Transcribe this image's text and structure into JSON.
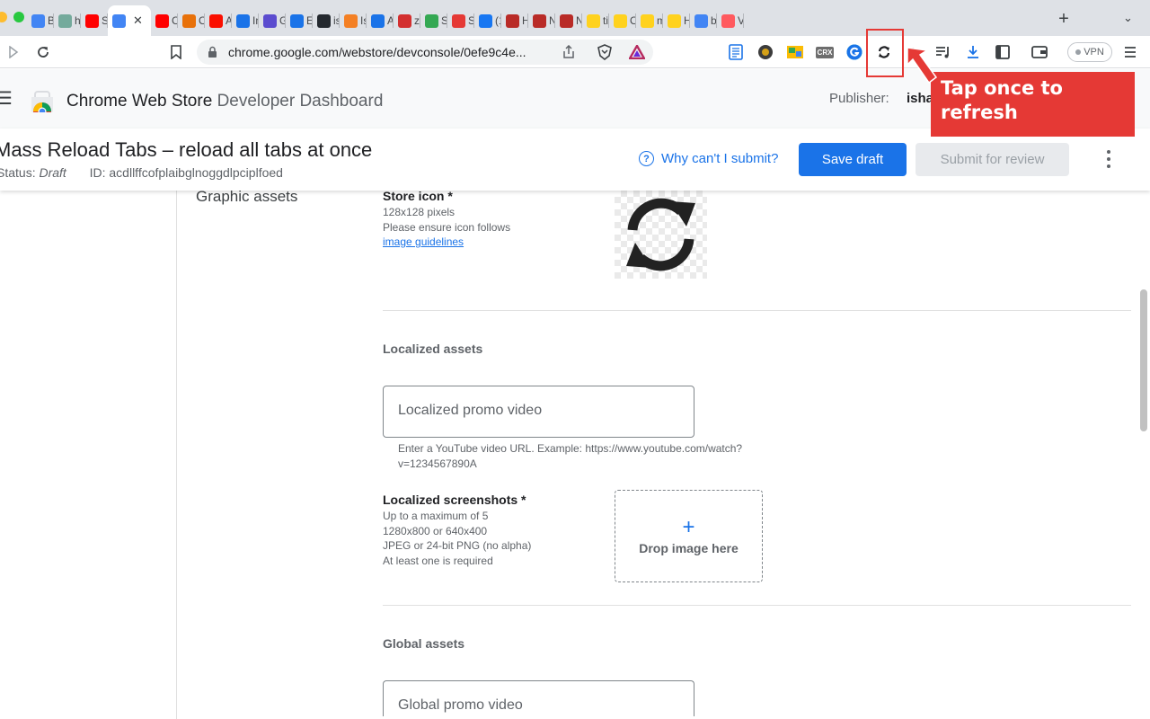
{
  "browser": {
    "tabs": [
      {
        "title": "Ba",
        "icon": "sparkle-icon",
        "color": "#4285f4"
      },
      {
        "title": "ht",
        "icon": "chatgpt-icon",
        "color": "#74aa9c"
      },
      {
        "title": "St",
        "icon": "youtube-icon",
        "color": "#ff0000"
      },
      {
        "title": "",
        "icon": "webstore-icon",
        "color": "#4285f4",
        "active": true
      },
      {
        "title": "C",
        "icon": "youtube-icon",
        "color": "#ff0000"
      },
      {
        "title": "O",
        "icon": "nbc-icon",
        "color": "#e8710a"
      },
      {
        "title": "A",
        "icon": "adobe-icon",
        "color": "#fa0f00"
      },
      {
        "title": "In",
        "icon": "globe-icon",
        "color": "#1a73e8"
      },
      {
        "title": "G",
        "icon": "r-logo-icon",
        "color": "#5b4ccf"
      },
      {
        "title": "E",
        "icon": "puzzle-icon",
        "color": "#1a73e8"
      },
      {
        "title": "is",
        "icon": "github-icon",
        "color": "#24292f"
      },
      {
        "title": "Is",
        "icon": "stackoverflow-icon",
        "color": "#f48024"
      },
      {
        "title": "A",
        "icon": "people-icon",
        "color": "#1a73e8"
      },
      {
        "title": "zl",
        "icon": "n-logo-icon",
        "color": "#d32f2f"
      },
      {
        "title": "S",
        "icon": "webstore-icon",
        "color": "#34a853"
      },
      {
        "title": "S",
        "icon": "record-icon",
        "color": "#e53935"
      },
      {
        "title": "(1",
        "icon": "facebook-icon",
        "color": "#1877f2"
      },
      {
        "title": "H",
        "icon": "quora-icon",
        "color": "#b92b27"
      },
      {
        "title": "N",
        "icon": "quora-icon",
        "color": "#b92b27"
      },
      {
        "title": "N",
        "icon": "quora-icon",
        "color": "#b92b27"
      },
      {
        "title": "ti",
        "icon": "hugging-face-icon",
        "color": "#ffd21e"
      },
      {
        "title": "O",
        "icon": "hugging-face-icon",
        "color": "#ffd21e"
      },
      {
        "title": "m",
        "icon": "hugging-face-icon",
        "color": "#ffd21e"
      },
      {
        "title": "H",
        "icon": "hugging-face-icon",
        "color": "#ffd21e"
      },
      {
        "title": "bl",
        "icon": "google-icon",
        "color": "#4285f4"
      },
      {
        "title": "Vi",
        "icon": "app-icon",
        "color": "#ff5a5f"
      }
    ],
    "close_glyph": "✕",
    "new_tab_glyph": "+",
    "url": "chrome.google.com/webstore/devconsole/0efe9c4e...",
    "vpn_label": "VPN",
    "extension_icons": {
      "crx_label": "CRX"
    }
  },
  "header": {
    "title_main": "Chrome Web Store",
    "title_sub": "Developer Dashboard",
    "publisher_label": "Publisher:",
    "publisher_name": "isha"
  },
  "item": {
    "title": "Mass Reload Tabs – reload all tabs at once",
    "status_label": "Status:",
    "status_value": "Draft",
    "id_label": "ID: acdllffcofplaibglnoggdlpciplfoed",
    "why_link": "Why can't I submit?",
    "save_draft": "Save draft",
    "submit_review": "Submit for review"
  },
  "content": {
    "section_title": "Graphic assets",
    "store_icon": {
      "label": "Store icon *",
      "help1": "128x128 pixels",
      "help2": "Please ensure icon follows",
      "link": "image guidelines"
    },
    "localized": {
      "title": "Localized assets",
      "video_placeholder": "Localized promo video",
      "video_help1": "Enter a YouTube video URL. Example: https://www.youtube.com/watch?",
      "video_help2": "v=1234567890A",
      "screenshots_label": "Localized screenshots *",
      "screenshots_help": [
        "Up to a maximum of 5",
        "1280x800 or 640x400",
        "JPEG or 24-bit PNG (no alpha)",
        "At least one is required"
      ],
      "drop_label": "Drop image here"
    },
    "global": {
      "title": "Global assets",
      "video_placeholder": "Global promo video"
    }
  },
  "annotation": {
    "callout_line1": "Tap once to",
    "callout_line2": "refresh",
    "color": "#e53935"
  }
}
